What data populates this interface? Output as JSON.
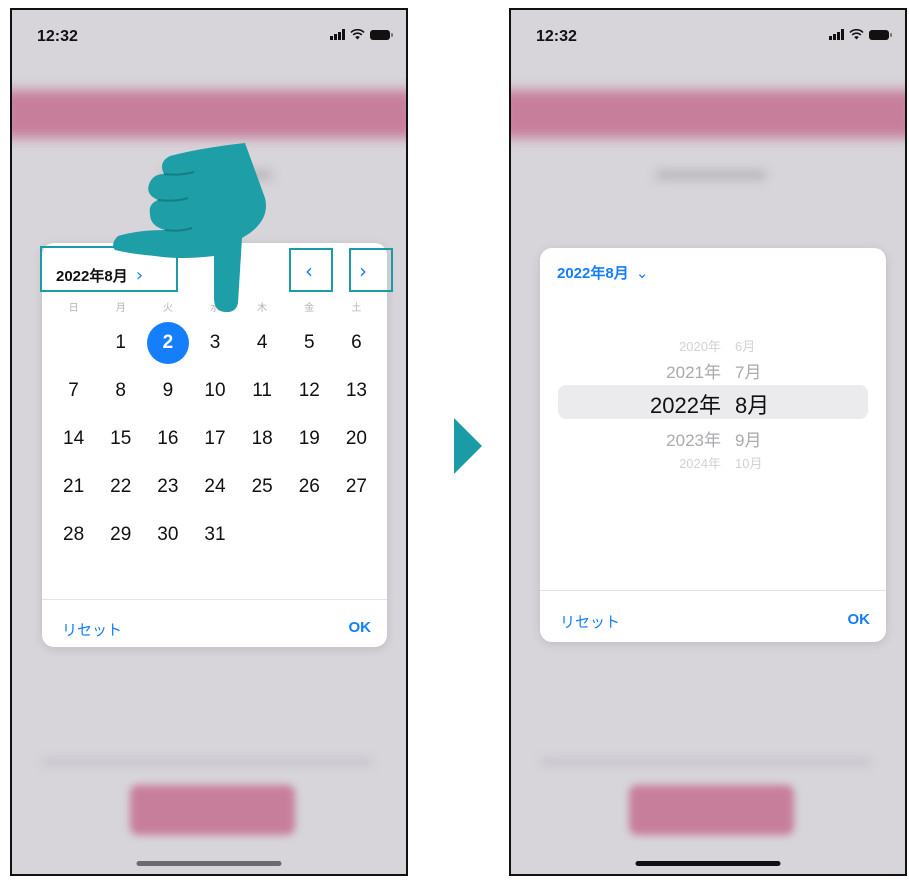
{
  "phone_left": {
    "status": {
      "time": "12:32"
    },
    "calendar": {
      "month_label": "2022年8月",
      "chevron_next_glyph": "›",
      "prev_glyph": "‹",
      "next_glyph": "›",
      "weekdays": [
        "日",
        "月",
        "火",
        "水",
        "木",
        "金",
        "土"
      ],
      "first_weekday_offset": 1,
      "days": [
        "1",
        "2",
        "3",
        "4",
        "5",
        "6",
        "7",
        "8",
        "9",
        "10",
        "11",
        "12",
        "13",
        "14",
        "15",
        "16",
        "17",
        "18",
        "19",
        "20",
        "21",
        "22",
        "23",
        "24",
        "25",
        "26",
        "27",
        "28",
        "29",
        "30",
        "31"
      ],
      "selected_day": "2",
      "reset_label": "リセット",
      "ok_label": "OK"
    }
  },
  "phone_right": {
    "status": {
      "time": "12:32"
    },
    "picker": {
      "month_label": "2022年8月",
      "chevron_glyph": "⌄",
      "rows": [
        {
          "year": "2020年",
          "month": "6月"
        },
        {
          "year": "2021年",
          "month": "7月"
        },
        {
          "year": "2022年",
          "month": "8月"
        },
        {
          "year": "2023年",
          "month": "9月"
        },
        {
          "year": "2024年",
          "month": "10月"
        }
      ],
      "reset_label": "リセット",
      "ok_label": "OK"
    }
  },
  "colors": {
    "accent": "#147efb",
    "highlight_teal": "#1b9ba6",
    "background_pink": "#c77e9b",
    "screen_gray": "#d7d5da"
  },
  "icons": [
    "cellular-signal-icon",
    "wifi-icon",
    "battery-icon",
    "pointing-hand-icon",
    "play-arrow-icon"
  ]
}
